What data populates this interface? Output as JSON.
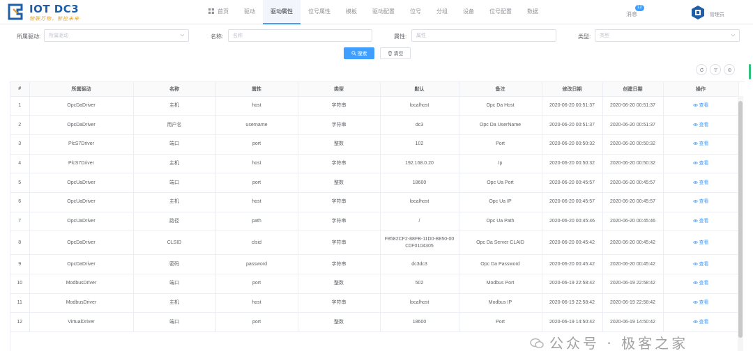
{
  "app": {
    "logo_title": "IOT DC3",
    "logo_slogan": "物联万物，智控未来"
  },
  "nav": {
    "items": [
      {
        "label": "首页"
      },
      {
        "label": "驱动"
      },
      {
        "label": "驱动属性",
        "active": true
      },
      {
        "label": "位号属性"
      },
      {
        "label": "模板"
      },
      {
        "label": "驱动配置"
      },
      {
        "label": "位号"
      },
      {
        "label": "分组"
      },
      {
        "label": "设备"
      },
      {
        "label": "位号配置"
      },
      {
        "label": "数据"
      }
    ]
  },
  "header": {
    "message_label": "消息",
    "message_count": "12",
    "user_name": "管理员"
  },
  "filter": {
    "driver_label": "所属驱动:",
    "driver_placeholder": "所属驱动",
    "name_label": "名称:",
    "name_placeholder": "名称",
    "attr_label": "属性:",
    "attr_placeholder": "属性",
    "type_label": "类型:",
    "type_placeholder": "类型",
    "search_label": "搜索",
    "clear_label": "清空"
  },
  "table": {
    "headers": [
      "#",
      "所属驱动",
      "名称",
      "属性",
      "类型",
      "默认",
      "备注",
      "修改日期",
      "创建日期",
      "操作"
    ],
    "view_label": "查看",
    "rows": [
      {
        "no": "1",
        "driver": "OpcDaDriver",
        "name": "主机",
        "attr": "host",
        "type": "字符串",
        "default": "localhost",
        "remark": "Opc Da Host",
        "modified": "2020-06-20 00:51:37",
        "created": "2020-06-20 00:51:37"
      },
      {
        "no": "2",
        "driver": "OpcDaDriver",
        "name": "用户名",
        "attr": "username",
        "type": "字符串",
        "default": "dc3",
        "remark": "Opc Da UserName",
        "modified": "2020-06-20 00:51:37",
        "created": "2020-06-20 00:51:37"
      },
      {
        "no": "3",
        "driver": "PlcS7Driver",
        "name": "端口",
        "attr": "port",
        "type": "整数",
        "default": "102",
        "remark": "Port",
        "modified": "2020-06-20 00:50:32",
        "created": "2020-06-20 00:50:32"
      },
      {
        "no": "4",
        "driver": "PlcS7Driver",
        "name": "主机",
        "attr": "host",
        "type": "字符串",
        "default": "192.168.0.20",
        "remark": "Ip",
        "modified": "2020-06-20 00:50:32",
        "created": "2020-06-20 00:50:32"
      },
      {
        "no": "5",
        "driver": "OpcUaDriver",
        "name": "端口",
        "attr": "port",
        "type": "整数",
        "default": "18600",
        "remark": "Opc Ua Port",
        "modified": "2020-06-20 00:45:57",
        "created": "2020-06-20 00:45:57"
      },
      {
        "no": "6",
        "driver": "OpcUaDriver",
        "name": "主机",
        "attr": "host",
        "type": "字符串",
        "default": "localhost",
        "remark": "Opc Ua IP",
        "modified": "2020-06-20 00:45:57",
        "created": "2020-06-20 00:45:57"
      },
      {
        "no": "7",
        "driver": "OpcUaDriver",
        "name": "路径",
        "attr": "path",
        "type": "字符串",
        "default": "/",
        "remark": "Opc Ua Path",
        "modified": "2020-06-20 00:45:46",
        "created": "2020-06-20 00:45:46"
      },
      {
        "no": "8",
        "driver": "OpcDaDriver",
        "name": "CLSID",
        "attr": "clsid",
        "type": "字符串",
        "default": "F8582CF2-88FB-11D0-B850-00C0F0104305",
        "remark": "Opc Da Server CLAID",
        "modified": "2020-06-20 00:45:42",
        "created": "2020-06-20 00:45:42",
        "tall": true
      },
      {
        "no": "9",
        "driver": "OpcDaDriver",
        "name": "密码",
        "attr": "password",
        "type": "字符串",
        "default": "dc3dc3",
        "remark": "Opc Da Password",
        "modified": "2020-06-20 00:45:42",
        "created": "2020-06-20 00:45:42"
      },
      {
        "no": "10",
        "driver": "ModbusDriver",
        "name": "端口",
        "attr": "port",
        "type": "整数",
        "default": "502",
        "remark": "Modbus Port",
        "modified": "2020-06-19 22:58:42",
        "created": "2020-06-19 22:58:42"
      },
      {
        "no": "11",
        "driver": "ModbusDriver",
        "name": "主机",
        "attr": "host",
        "type": "字符串",
        "default": "localhost",
        "remark": "Modbus IP",
        "modified": "2020-06-19 22:58:42",
        "created": "2020-06-19 22:58:42"
      },
      {
        "no": "12",
        "driver": "VirtualDriver",
        "name": "端口",
        "attr": "port",
        "type": "整数",
        "default": "18600",
        "remark": "Port",
        "modified": "2020-06-19 14:50:42",
        "created": "2020-06-19 14:50:42"
      }
    ]
  },
  "watermark": {
    "text": "公众号 · 极客之家"
  },
  "colors": {
    "primary": "#409eff",
    "border": "#ebeef5",
    "text": "#606266",
    "header_bg": "#fafafa"
  }
}
